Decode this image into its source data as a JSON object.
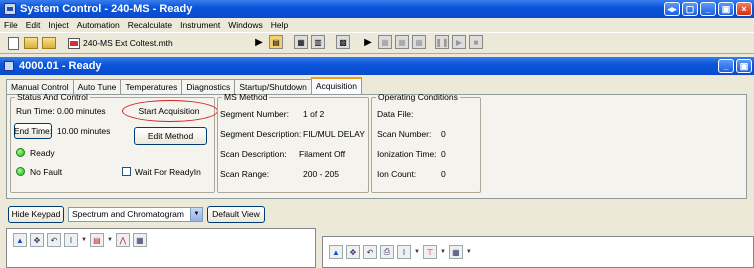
{
  "window": {
    "title": "System Control - 240-MS - Ready"
  },
  "menu": [
    "File",
    "Edit",
    "Inject",
    "Automation",
    "Recalculate",
    "Instrument",
    "Windows",
    "Help"
  ],
  "toolbar": {
    "method_file": "240-MS Ext Coltest.mth"
  },
  "inner_window": {
    "title": "4000.01 - Ready"
  },
  "tabs": [
    {
      "label": "Manual Control",
      "active": false
    },
    {
      "label": "Auto Tune",
      "active": false
    },
    {
      "label": "Temperatures",
      "active": false
    },
    {
      "label": "Diagnostics",
      "active": false
    },
    {
      "label": "Startup/Shutdown",
      "active": false
    },
    {
      "label": "Acquisition",
      "active": true
    }
  ],
  "status": {
    "group_title": "Status And Control",
    "run_time_label": "Run Time:",
    "run_time_value": "0.00 minutes",
    "end_time_button": "End Time:",
    "end_time_value": "10.00 minutes",
    "start_button": "Start Acquisition",
    "edit_button": "Edit Method",
    "ready": "Ready",
    "no_fault": "No Fault",
    "wait_label": "Wait For ReadyIn"
  },
  "ms_method": {
    "group_title": "MS Method",
    "segment_number_label": "Segment Number:",
    "segment_number_value": "1 of 2",
    "segment_description_label": "Segment Description:",
    "segment_description_value": "FIL/MUL DELAY",
    "scan_description_label": "Scan Description:",
    "scan_description_value": "Filament Off",
    "scan_range_label": "Scan Range:",
    "scan_range_value": "200 - 205"
  },
  "operating": {
    "group_title": "Operating Conditions",
    "data_file_label": "Data File:",
    "scan_number_label": "Scan Number:",
    "scan_number_value": "0",
    "ionization_label": "Ionization Time:",
    "ionization_value": "0",
    "ion_count_label": "Ion Count:",
    "ion_count_value": "0"
  },
  "viewbar": {
    "hide_keypad": "Hide Keypad",
    "view_select": "Spectrum and Chromatogram",
    "default_view": "Default View"
  },
  "colors": {
    "title_blue": "#0a55d8",
    "highlight_red": "#d02020",
    "led_green": "#20b020"
  }
}
